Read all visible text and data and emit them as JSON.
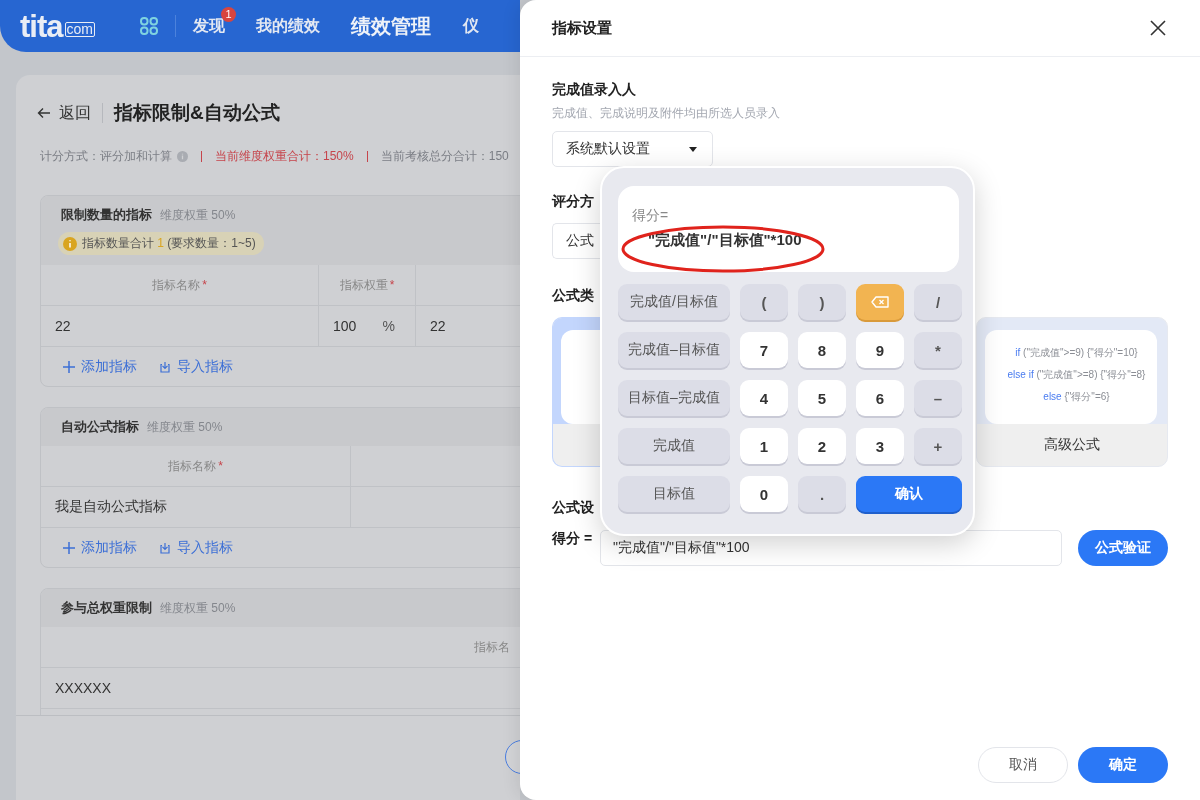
{
  "nav": {
    "logo": "tita",
    "logo_suffix": "com",
    "items": [
      {
        "label": "发现",
        "selected": false,
        "badge": "1"
      },
      {
        "label": "我的绩效",
        "selected": false
      },
      {
        "label": "绩效管理",
        "selected": true
      },
      {
        "label": "仪",
        "selected": false
      }
    ]
  },
  "page": {
    "back": "返回",
    "title": "指标限制&自动公式",
    "summary": [
      {
        "text": "计分方式：评分加和计算",
        "kind": "info"
      },
      {
        "text": "当前维度权重合计：150%",
        "kind": "alert"
      },
      {
        "text": "当前考核总分合计：150",
        "kind": "plain"
      }
    ],
    "sections": [
      {
        "title": "限制数量的指标",
        "weight": "维度权重 50%",
        "notice": {
          "prefix": "指标数量合计",
          "count": "1",
          "suffix": "(要求数量：1~5)"
        },
        "columns": [
          {
            "label": "指标名称",
            "required_mark": "*"
          },
          {
            "label": "指标权重",
            "required_mark": "*"
          }
        ],
        "rows": [
          [
            {
              "text": "22"
            },
            {
              "text": "100",
              "unit": "%"
            },
            {
              "text": "22"
            }
          ]
        ],
        "actions": [
          {
            "kind": "add",
            "label": "添加指标"
          },
          {
            "kind": "import",
            "label": "导入指标"
          }
        ]
      },
      {
        "title": "自动公式指标",
        "weight": "维度权重 50%",
        "columns": [
          {
            "label": "指标名称",
            "required_mark": "*"
          }
        ],
        "rows": [
          [
            {
              "text": "我是自动公式指标"
            }
          ]
        ],
        "actions": [
          {
            "kind": "add",
            "label": "添加指标"
          },
          {
            "kind": "import",
            "label": "导入指标"
          }
        ]
      },
      {
        "title": "参与总权重限制",
        "weight": "维度权重 50%",
        "columns": [
          {
            "label": "指标名"
          }
        ],
        "rows": [
          [
            {
              "text": "XXXXXX"
            }
          ]
        ]
      }
    ]
  },
  "drawer": {
    "title": "指标设置",
    "entry_label": "完成值录入人",
    "entry_hint": "完成值、完成说明及附件均由所选人员录入",
    "entry_select": "系统默认设置",
    "scoring_label": "评分方",
    "scoring_select": "公式",
    "type_label": "公式类",
    "formula_types": [
      {
        "selected": true
      },
      {
        "selected": false,
        "title": "高级公式",
        "code": [
          {
            "keyword": "if",
            "rest": " (\"完成值\">=9) {\"得分\"=10}"
          },
          {
            "keyword": "else if",
            "rest": " (\"完成值\">=8) {\"得分\"=8}"
          },
          {
            "keyword": "else",
            "rest": " {\"得分\"=6}"
          }
        ]
      }
    ],
    "formula_label": "公式设",
    "score_label": "得分 =",
    "formula_value": "\"完成值\"/\"目标值\"*100",
    "verify": "公式验证",
    "cancel": "取消",
    "ok": "确定"
  },
  "calculator": {
    "display_label": "得分=",
    "display_formula": "\"完成值\"/\"目标值\"*100",
    "keys": [
      {
        "kind": "field",
        "label": "完成值/目标值"
      },
      {
        "kind": "operator",
        "label": "("
      },
      {
        "kind": "operator",
        "label": ")"
      },
      {
        "kind": "backspace"
      },
      {
        "kind": "operator",
        "label": "/"
      },
      {
        "kind": "field",
        "label": "完成值–目标值"
      },
      {
        "kind": "number",
        "label": "7"
      },
      {
        "kind": "number",
        "label": "8"
      },
      {
        "kind": "number",
        "label": "9"
      },
      {
        "kind": "operator",
        "label": "*"
      },
      {
        "kind": "field",
        "label": "目标值–完成值"
      },
      {
        "kind": "number",
        "label": "4"
      },
      {
        "kind": "number",
        "label": "5"
      },
      {
        "kind": "number",
        "label": "6"
      },
      {
        "kind": "operator",
        "label": "–"
      },
      {
        "kind": "field",
        "label": "完成值"
      },
      {
        "kind": "number",
        "label": "1"
      },
      {
        "kind": "number",
        "label": "2"
      },
      {
        "kind": "number",
        "label": "3"
      },
      {
        "kind": "operator",
        "label": "+"
      },
      {
        "kind": "field",
        "label": "目标值"
      },
      {
        "kind": "number",
        "label": "0"
      },
      {
        "kind": "operator",
        "label": "."
      },
      {
        "kind": "confirm",
        "label": "确认"
      }
    ]
  }
}
